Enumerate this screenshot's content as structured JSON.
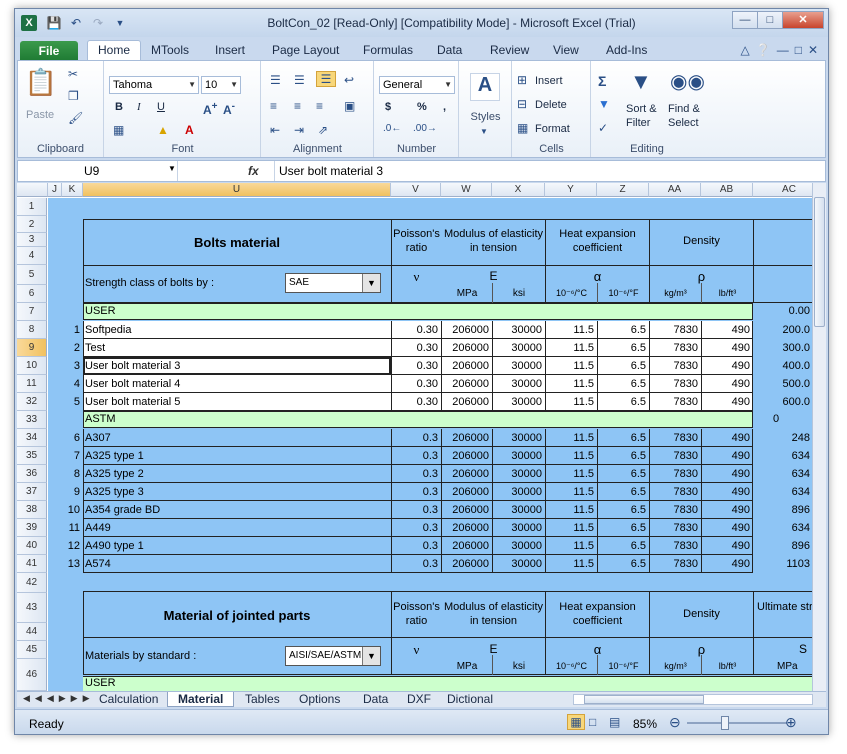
{
  "window": {
    "title": "BoltCon_02  [Read-Only]  [Compatibility Mode]  -  Microsoft Excel (Trial)",
    "app_icon": "X"
  },
  "ribbon_tabs": [
    "File",
    "Home",
    "MTools",
    "Insert",
    "Page Layout",
    "Formulas",
    "Data",
    "Review",
    "View",
    "Add-Ins"
  ],
  "ribbon": {
    "clipboard": {
      "label": "Clipboard",
      "paste": "Paste"
    },
    "font": {
      "label": "Font",
      "name": "Tahoma",
      "size": "10",
      "bold": "B",
      "italic": "I",
      "underline": "U"
    },
    "alignment": {
      "label": "Alignment"
    },
    "number": {
      "label": "Number",
      "format": "General",
      "currency": "$",
      "percent": "%",
      "comma": ","
    },
    "styles": {
      "label": "Styles"
    },
    "cells": {
      "label": "Cells",
      "insert": "Insert",
      "delete": "Delete",
      "format": "Format"
    },
    "editing": {
      "label": "Editing",
      "sort": "Sort &",
      "filter": "Filter",
      "find": "Find &",
      "select": "Select"
    }
  },
  "formula_bar": {
    "name_box": "U9",
    "fx": "fx",
    "content": "User bolt material 3"
  },
  "columns": [
    "J",
    "K",
    "U",
    "V",
    "W",
    "X",
    "Y",
    "Z",
    "AA",
    "AB",
    "AC"
  ],
  "rows": [
    "1",
    "2",
    "3",
    "4",
    "5",
    "6",
    "7",
    "8",
    "9",
    "10",
    "11",
    "32",
    "33",
    "34",
    "35",
    "36",
    "37",
    "38",
    "39",
    "40",
    "41",
    "42",
    "43",
    "44",
    "45",
    "46"
  ],
  "bolts": {
    "title": "Bolts material",
    "poisson": "Poisson's ratio",
    "modulus": "Modulus of elasticity in tension",
    "heat": "Heat expansion coefficient",
    "density": "Density",
    "sym_nu": "ν",
    "sym_E": "E",
    "sym_alpha": "α",
    "sym_rho": "ρ",
    "unit_mpa": "MPa",
    "unit_ksi": "ksi",
    "unit_c": "10⁻⁶/°C",
    "unit_f": "10⁻⁶/°F",
    "unit_kgm3": "kg/m³",
    "unit_lbft3": "lb/ft³",
    "strength_label": "Strength class of bolts by :",
    "strength_value": "SAE",
    "user_label": "USER",
    "user_ac": "0.00",
    "astm_label": "ASTM",
    "astm_ac": "0"
  },
  "user_rows": [
    {
      "n": "1",
      "name": "Softpedia",
      "nu": "0.30",
      "mpa": "206000",
      "ksi": "30000",
      "c": "11.5",
      "f": "6.5",
      "kg": "7830",
      "lb": "490",
      "ac": "200.0"
    },
    {
      "n": "2",
      "name": "Test",
      "nu": "0.30",
      "mpa": "206000",
      "ksi": "30000",
      "c": "11.5",
      "f": "6.5",
      "kg": "7830",
      "lb": "490",
      "ac": "300.0"
    },
    {
      "n": "3",
      "name": "User bolt material 3",
      "nu": "0.30",
      "mpa": "206000",
      "ksi": "30000",
      "c": "11.5",
      "f": "6.5",
      "kg": "7830",
      "lb": "490",
      "ac": "400.0"
    },
    {
      "n": "4",
      "name": "User bolt material 4",
      "nu": "0.30",
      "mpa": "206000",
      "ksi": "30000",
      "c": "11.5",
      "f": "6.5",
      "kg": "7830",
      "lb": "490",
      "ac": "500.0"
    },
    {
      "n": "5",
      "name": "User bolt material 5",
      "nu": "0.30",
      "mpa": "206000",
      "ksi": "30000",
      "c": "11.5",
      "f": "6.5",
      "kg": "7830",
      "lb": "490",
      "ac": "600.0"
    }
  ],
  "astm_rows": [
    {
      "n": "6",
      "name": "A307",
      "nu": "0.3",
      "mpa": "206000",
      "ksi": "30000",
      "c": "11.5",
      "f": "6.5",
      "kg": "7830",
      "lb": "490",
      "ac": "248"
    },
    {
      "n": "7",
      "name": "A325 type 1",
      "nu": "0.3",
      "mpa": "206000",
      "ksi": "30000",
      "c": "11.5",
      "f": "6.5",
      "kg": "7830",
      "lb": "490",
      "ac": "634"
    },
    {
      "n": "8",
      "name": "A325 type 2",
      "nu": "0.3",
      "mpa": "206000",
      "ksi": "30000",
      "c": "11.5",
      "f": "6.5",
      "kg": "7830",
      "lb": "490",
      "ac": "634"
    },
    {
      "n": "9",
      "name": "A325 type 3",
      "nu": "0.3",
      "mpa": "206000",
      "ksi": "30000",
      "c": "11.5",
      "f": "6.5",
      "kg": "7830",
      "lb": "490",
      "ac": "634"
    },
    {
      "n": "10",
      "name": "A354 grade BD",
      "nu": "0.3",
      "mpa": "206000",
      "ksi": "30000",
      "c": "11.5",
      "f": "6.5",
      "kg": "7830",
      "lb": "490",
      "ac": "896"
    },
    {
      "n": "11",
      "name": "A449",
      "nu": "0.3",
      "mpa": "206000",
      "ksi": "30000",
      "c": "11.5",
      "f": "6.5",
      "kg": "7830",
      "lb": "490",
      "ac": "634"
    },
    {
      "n": "12",
      "name": "A490 type 1",
      "nu": "0.3",
      "mpa": "206000",
      "ksi": "30000",
      "c": "11.5",
      "f": "6.5",
      "kg": "7830",
      "lb": "490",
      "ac": "896"
    },
    {
      "n": "13",
      "name": "A574",
      "nu": "0.3",
      "mpa": "206000",
      "ksi": "30000",
      "c": "11.5",
      "f": "6.5",
      "kg": "7830",
      "lb": "490",
      "ac": "1103"
    }
  ],
  "joint": {
    "title": "Material of jointed parts",
    "poisson": "Poisson's ratio",
    "modulus": "Modulus of elasticity in tension",
    "heat": "Heat expansion coefficient",
    "density": "Density",
    "ultimate": "Ultimate stre",
    "std_label": "Materials by standard :",
    "std_value": "AISI/SAE/ASTM",
    "sym_S": "S",
    "user_label": "USER"
  },
  "sheet_tabs": [
    "Calculation",
    "Material",
    "Tables",
    "Options",
    "Data",
    "DXF",
    "Dictional"
  ],
  "active_sheet": "Material",
  "status": {
    "ready": "Ready",
    "zoom": "85%"
  },
  "colors": {
    "sheet_blue": "#8ec5f5",
    "user_green": "#ccffcc",
    "excel_green": "#1e7145"
  }
}
